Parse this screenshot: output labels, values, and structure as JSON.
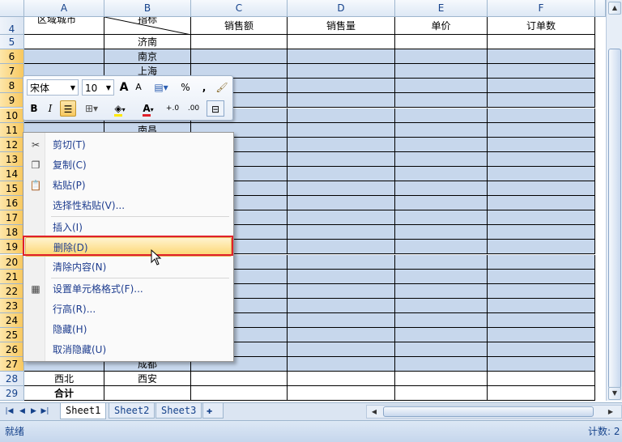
{
  "columns": [
    "A",
    "B",
    "C",
    "D",
    "E",
    "F"
  ],
  "header_row": {
    "row": "4",
    "a_top": "区域城市",
    "b_top": "指标",
    "c": "销售额",
    "d": "销售量",
    "e": "单价",
    "f": "订单数"
  },
  "rows": [
    {
      "num": "5",
      "a": "",
      "b": "济南"
    },
    {
      "num": "6",
      "a": "",
      "b": "南京"
    },
    {
      "num": "7",
      "a": "",
      "b": "上海"
    },
    {
      "num": "8",
      "a": "",
      "b": ""
    },
    {
      "num": "9",
      "a": "",
      "b": ""
    },
    {
      "num": "10",
      "a": "",
      "b": ""
    },
    {
      "num": "11",
      "a": "",
      "b": "南昌"
    },
    {
      "num": "12",
      "a": "",
      "b": ""
    },
    {
      "num": "13",
      "a": "",
      "b": ""
    },
    {
      "num": "14",
      "a": "",
      "b": ""
    },
    {
      "num": "15",
      "a": "",
      "b": ""
    },
    {
      "num": "16",
      "a": "",
      "b": ""
    },
    {
      "num": "17",
      "a": "",
      "b": ""
    },
    {
      "num": "18",
      "a": "",
      "b": ""
    },
    {
      "num": "19",
      "a": "",
      "b": ""
    },
    {
      "num": "20",
      "a": "",
      "b": ""
    },
    {
      "num": "21",
      "a": "",
      "b": ""
    },
    {
      "num": "22",
      "a": "",
      "b": ""
    },
    {
      "num": "23",
      "a": "",
      "b": ""
    },
    {
      "num": "24",
      "a": "",
      "b": ""
    },
    {
      "num": "25",
      "a": "",
      "b": ""
    },
    {
      "num": "26",
      "a": "",
      "b": ""
    },
    {
      "num": "27",
      "a": "",
      "b": "成都"
    },
    {
      "num": "28",
      "a": "西北",
      "b": "西安"
    },
    {
      "num": "29",
      "a": "合计",
      "b": ""
    }
  ],
  "mini_toolbar": {
    "font_name": "宋体",
    "font_size": "10",
    "grow_font": "A",
    "shrink_font": "A",
    "percent": "%",
    "comma": ",",
    "bold": "B",
    "italic": "I",
    "font_color_glyph": "A",
    "inc_decimal": "+.0",
    "dec_decimal": ".00"
  },
  "context_menu": [
    {
      "label": "剪切(T)",
      "icon": "scissors-icon",
      "glyph": "✂"
    },
    {
      "label": "复制(C)",
      "icon": "copy-icon",
      "glyph": "❐"
    },
    {
      "label": "粘贴(P)",
      "icon": "paste-icon",
      "glyph": "📋"
    },
    {
      "label": "选择性粘贴(V)...",
      "icon": "",
      "glyph": ""
    },
    {
      "label": "插入(I)",
      "icon": "",
      "glyph": ""
    },
    {
      "label": "删除(D)",
      "icon": "",
      "glyph": ""
    },
    {
      "label": "清除内容(N)",
      "icon": "",
      "glyph": ""
    },
    {
      "label": "设置单元格格式(F)...",
      "icon": "format-cells-icon",
      "glyph": "▦"
    },
    {
      "label": "行高(R)...",
      "icon": "",
      "glyph": ""
    },
    {
      "label": "隐藏(H)",
      "icon": "",
      "glyph": ""
    },
    {
      "label": "取消隐藏(U)",
      "icon": "",
      "glyph": ""
    }
  ],
  "sheets": [
    "Sheet1",
    "Sheet2",
    "Sheet3"
  ],
  "status": {
    "left": "就绪",
    "right": "计数: 2"
  }
}
